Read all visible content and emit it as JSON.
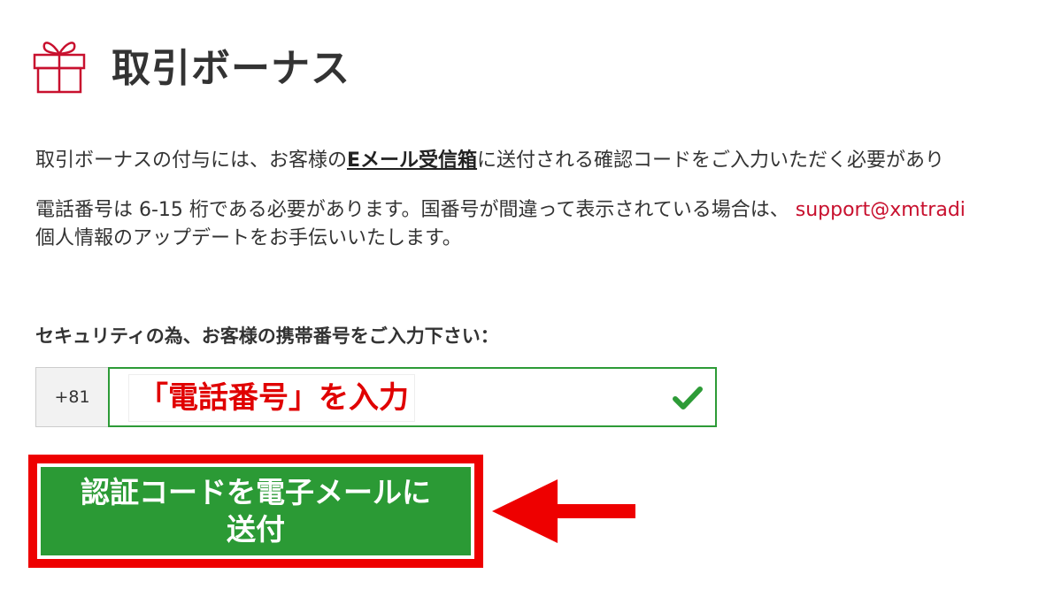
{
  "header": {
    "title": "取引ボーナス",
    "icon": "gift-icon",
    "icon_color": "#c8102e"
  },
  "info": {
    "line1_prefix": "取引ボーナスの付与には、お客様の",
    "line1_link": "Eメール受信箱",
    "line1_suffix": "に送付される確認コードをご入力いただく必要があり",
    "line2_prefix": "電話番号は ",
    "line2_digits": "6-15",
    "line2_middle": " 桁である必要があります。国番号が間違って表示されている場合は、 ",
    "support_email": "support@xmtradi",
    "line3": "個人情報のアップデートをお手伝いいたします。"
  },
  "phone": {
    "label": "セキュリティの為、お客様の携帯番号をご入力下さい：",
    "country_code": "+81",
    "annotation": "「電話番号」を入力",
    "valid_icon": "check-icon",
    "valid_color": "#2d9b37"
  },
  "send_button": {
    "label": "認証コードを電子メールに送付",
    "color": "#2b9a35",
    "highlight_color": "#ee0000"
  },
  "annotation_arrow": {
    "icon": "left-arrow-icon",
    "color": "#ee0000"
  }
}
